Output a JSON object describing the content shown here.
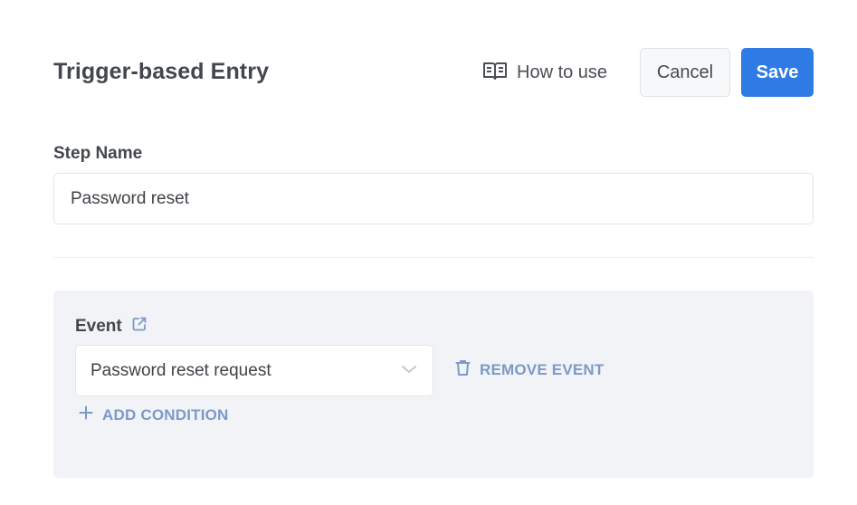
{
  "header": {
    "title": "Trigger-based Entry",
    "how_to_use": "How to use",
    "cancel": "Cancel",
    "save": "Save"
  },
  "step_name": {
    "label": "Step Name",
    "value": "Password reset"
  },
  "event": {
    "label": "Event",
    "selected": "Password reset request",
    "remove_label": "REMOVE EVENT",
    "add_condition_label": "ADD CONDITION"
  },
  "icons": {
    "how_to_use": "book-open-icon",
    "event_link": "external-link-icon",
    "select_caret": "chevron-down-icon",
    "remove": "trash-icon",
    "add": "plus-icon"
  },
  "colors": {
    "primary": "#2f7be5",
    "link": "#7b9ac9",
    "panel_bg": "#f2f3f6"
  }
}
